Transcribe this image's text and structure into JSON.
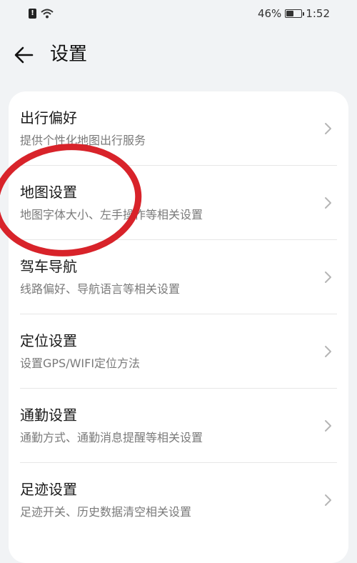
{
  "status_bar": {
    "sim_label": "!",
    "battery_percent": "46%",
    "time": "1:52",
    "battery_level": 0.46
  },
  "header": {
    "title": "设置"
  },
  "settings": [
    {
      "title": "出行偏好",
      "subtitle": "提供个性化地图出行服务"
    },
    {
      "title": "地图设置",
      "subtitle": "地图字体大小、左手操作等相关设置"
    },
    {
      "title": "驾车导航",
      "subtitle": "线路偏好、导航语言等相关设置"
    },
    {
      "title": "定位设置",
      "subtitle": "设置GPS/WIFI定位方法"
    },
    {
      "title": "通勤设置",
      "subtitle": "通勤方式、通勤消息提醒等相关设置"
    },
    {
      "title": "足迹设置",
      "subtitle": "足迹开关、历史数据清空相关设置"
    }
  ],
  "colors": {
    "annotation": "#d8232a",
    "background": "#f1f3f5",
    "card": "#ffffff"
  }
}
